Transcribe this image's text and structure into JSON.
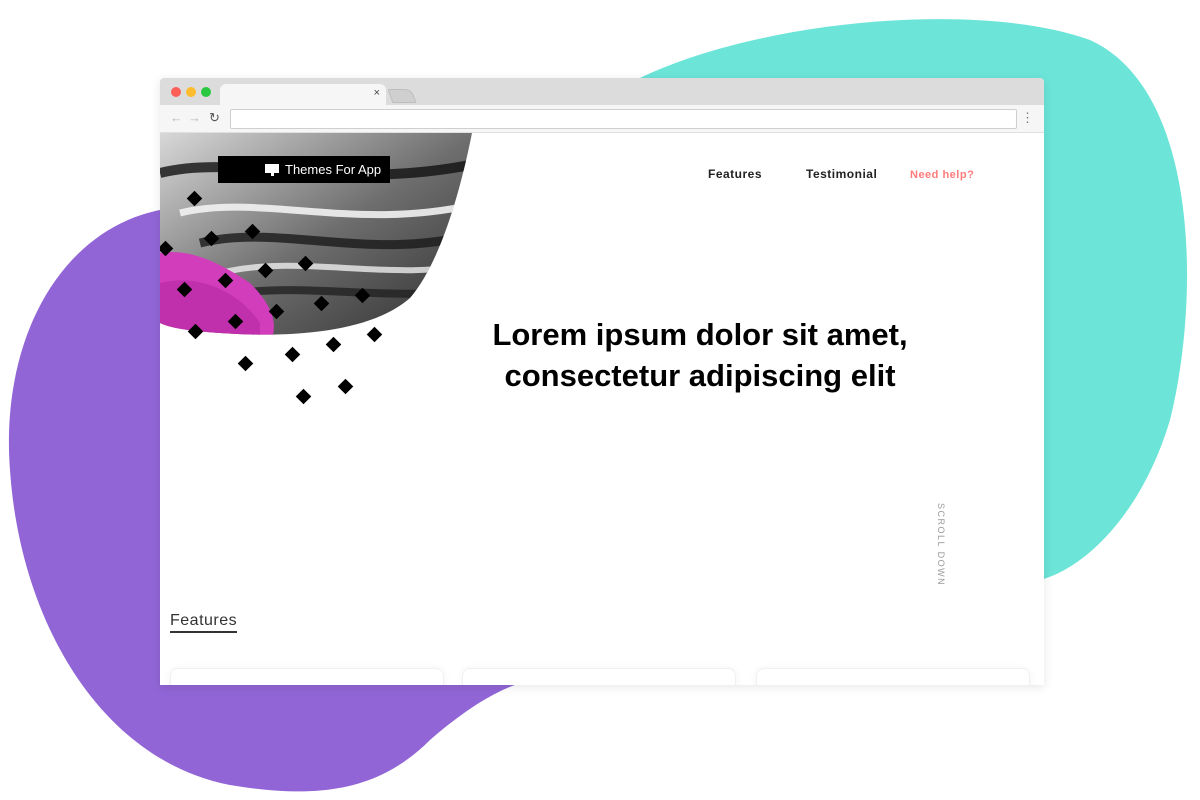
{
  "browser": {
    "tab_close": "×",
    "nav": {
      "back": "←",
      "forward": "→",
      "reload": "↻",
      "menu": "⋮"
    },
    "url": ""
  },
  "site": {
    "logo_text": "Themes For App",
    "nav": {
      "features": "Features",
      "testimonial": "Testimonial",
      "help": "Need help?"
    },
    "hero": {
      "title_line1": "Lorem ipsum dolor sit amet,",
      "title_line2": "consectetur adipiscing elit"
    },
    "scroll_down": "SCROLL DOWN",
    "section_title": "Features"
  },
  "colors": {
    "blob_teal": "#6ce4d8",
    "blob_purple": "#9165d6",
    "help_link": "#ff7b7b",
    "magenta_art": "#d23dbb"
  }
}
